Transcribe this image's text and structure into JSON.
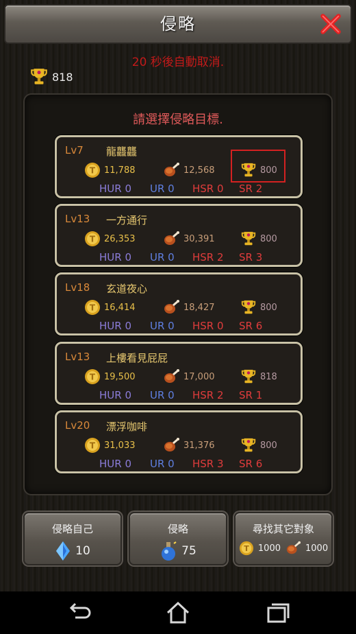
{
  "header": {
    "title": "侵略",
    "close_icon": "close-icon"
  },
  "countdown": "20 秒後自動取消.",
  "trophies": "818",
  "prompt": "請選擇侵略目標.",
  "targets": [
    {
      "level": "Lv7",
      "name": "龍龘龘",
      "gold": "11,788",
      "meat": "12,568",
      "trophies": "800",
      "hur": "HUR 0",
      "ur": "UR 0",
      "hsr": "HSR 0",
      "sr": "SR 2",
      "highlighted": true
    },
    {
      "level": "Lv13",
      "name": "一方通行",
      "gold": "26,353",
      "meat": "30,391",
      "trophies": "800",
      "hur": "HUR 0",
      "ur": "UR 0",
      "hsr": "HSR 2",
      "sr": "SR 3"
    },
    {
      "level": "Lv18",
      "name": "玄道夜心",
      "gold": "16,414",
      "meat": "18,427",
      "trophies": "800",
      "hur": "HUR 0",
      "ur": "UR 0",
      "hsr": "HSR 0",
      "sr": "SR 6"
    },
    {
      "level": "Lv13",
      "name": "上樓看見屁屁",
      "gold": "19,500",
      "meat": "17,000",
      "trophies": "818",
      "hur": "HUR 0",
      "ur": "UR 0",
      "hsr": "HSR 2",
      "sr": "SR 1"
    },
    {
      "level": "Lv20",
      "name": "漂浮咖啡",
      "gold": "31,033",
      "meat": "31,376",
      "trophies": "800",
      "hur": "HUR 0",
      "ur": "UR 0",
      "hsr": "HSR 3",
      "sr": "SR 6"
    }
  ],
  "buttons": {
    "invade_self": {
      "label": "侵略自己",
      "cost": "10",
      "icon": "crystal-icon"
    },
    "invade": {
      "label": "侵略",
      "cost": "75",
      "icon": "potion-icon"
    },
    "find_other": {
      "label": "尋找其它對象",
      "gold_cost": "1000",
      "meat_cost": "1000"
    }
  },
  "colors": {
    "accent_red": "#c21a1a",
    "gold": "#e9c04a"
  }
}
